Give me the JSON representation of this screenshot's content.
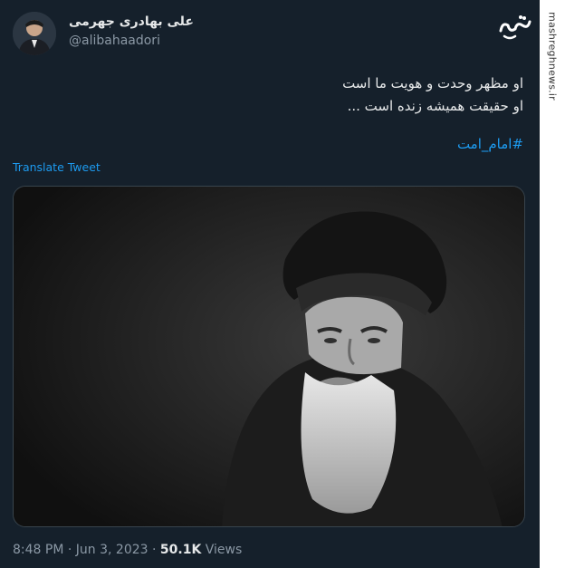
{
  "author": {
    "name": "علی بهادری جهرمی",
    "handle": "@alibahaadori"
  },
  "tweet": {
    "lines": [
      "او مظهر وحدت و هویت ما است",
      "او حقیقت همیشه زنده است ..."
    ],
    "hashtag": "#امام_امت",
    "translate_label": "Translate Tweet"
  },
  "meta": {
    "time": "8:48 PM",
    "separator": "·",
    "date": "Jun 3, 2023",
    "views_count": "50.1K",
    "views_label": "Views"
  },
  "watermark": {
    "logo_text": "مشرق",
    "site": "mashreghnews.ir"
  },
  "colors": {
    "background": "#15202b",
    "link": "#1d9bf0",
    "muted": "#8b98a5"
  },
  "icons": {
    "avatar": "profile-photo",
    "watermark": "mashregh-logo"
  }
}
